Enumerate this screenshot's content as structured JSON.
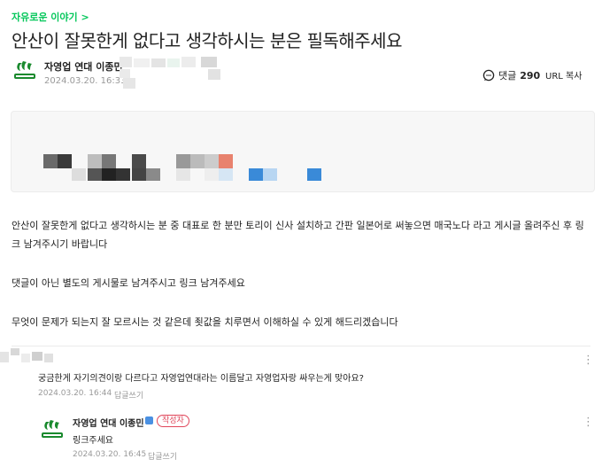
{
  "board": {
    "label": "자유로운 이야기 >"
  },
  "post": {
    "title": "안산이 잘못한게 없다고 생각하시는 분은 필독해주세요",
    "author": "자영업 연대 이종민",
    "date": "2024.03.20. 16:33",
    "paragraphs": [
      "안산이 잘못한게 없다고 생각하시는 분 중 대표로 한 분만 토리이 신사 설치하고 간판 일본어로 써놓으면 매국노다 라고 게시글 올려주신 후 링크 남겨주시기 바랍니다",
      "댓글이 아닌 별도의 게시물로 남겨주시고 링크 남겨주세요",
      "무엇이 문제가 되는지 잘 모르시는 것 같은데 죗값을 치루면서 이해하실 수 있게 해드리겠습니다"
    ]
  },
  "actions": {
    "comment_label": "댓글",
    "comment_count": "290",
    "url_copy": "URL 복사"
  },
  "comments": [
    {
      "text": "궁금한게 자기의견이랑 다르다고 자영업연대라는 이름달고 자영업자랑 싸우는게 맞아요?",
      "date": "2024.03.20. 16:44",
      "reply_label": "답글쓰기"
    }
  ],
  "reply": {
    "author": "자영업 연대 이종민",
    "badge": "작성자",
    "text": "링크주세요",
    "date": "2024.03.20. 16:45",
    "reply_label": "답글쓰기"
  },
  "colors": {
    "accent": "#03c75a",
    "badge": "#e0475b",
    "muted": "#999999"
  }
}
